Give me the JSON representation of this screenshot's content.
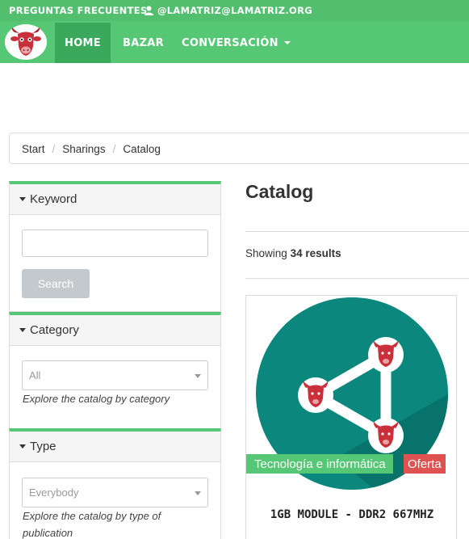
{
  "topbar": {
    "faq": "PREGUNTAS FRECUENTES",
    "user": "@LAMATRIZ@LAMATRIZ.ORG",
    "user_icon": "user-icon"
  },
  "nav": {
    "logo_icon": "bull-head-logo",
    "items": [
      {
        "label": "HOME",
        "active": true
      },
      {
        "label": "BAZAR",
        "active": false
      },
      {
        "label": "CONVERSACIÓN",
        "active": false,
        "dropdown": true
      }
    ]
  },
  "breadcrumb": [
    "Start",
    "Sharings",
    "Catalog"
  ],
  "filters": {
    "keyword": {
      "title": "Keyword",
      "value": "",
      "button": "Search"
    },
    "category": {
      "title": "Category",
      "selected": "All",
      "help": "Explore the catalog by category"
    },
    "type": {
      "title": "Type",
      "selected": "Everybody",
      "help": "Explore the catalog by type of publication"
    }
  },
  "main": {
    "heading": "Catalog",
    "showing_prefix": "Showing",
    "showing_count": "34 results"
  },
  "cards": [
    {
      "image_icon": "share-network-icon",
      "category": "Tecnología e informática",
      "badge": "Oferta",
      "title": "1GB MODULE - DDR2 667MHZ"
    }
  ],
  "colors": {
    "brand_green": "#51bf6e",
    "active_nav": "#3aa95b",
    "teal": "#0b877d",
    "offer_red": "#e05151"
  }
}
